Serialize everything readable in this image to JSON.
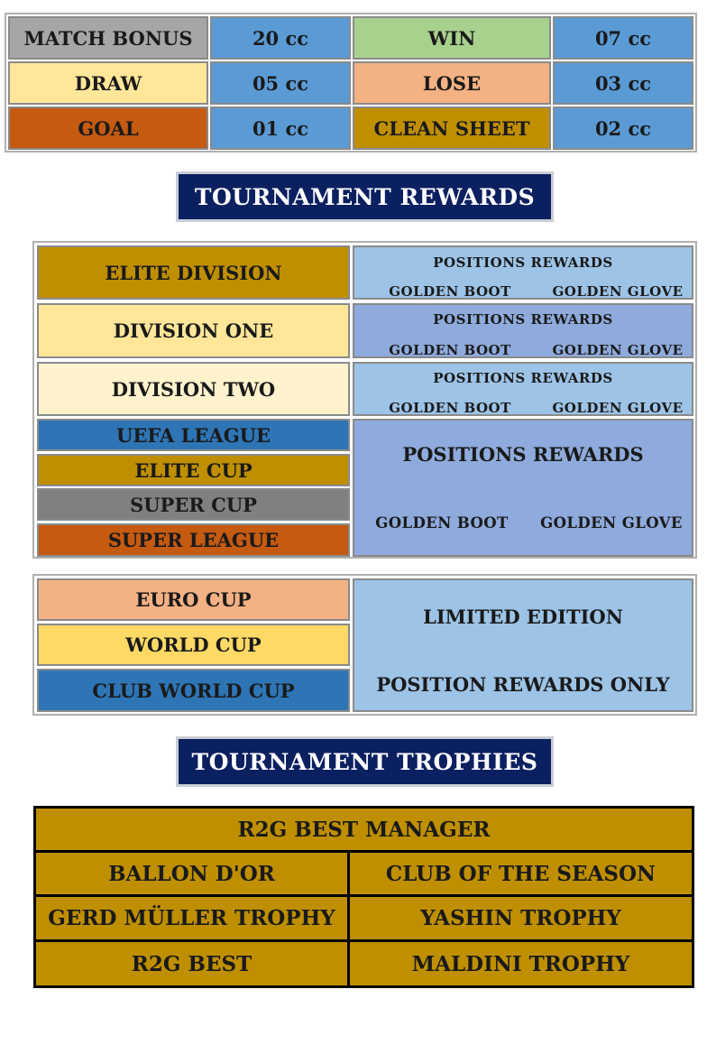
{
  "match_bonus": {
    "rows": [
      [
        {
          "text": "MATCH BONUS",
          "color": "#a6a6a6"
        },
        {
          "text": "20 cc",
          "color": "#5b9bd5"
        },
        {
          "text": "WIN",
          "color": "#a9d18e"
        },
        {
          "text": "07 cc",
          "color": "#5b9bd5"
        }
      ],
      [
        {
          "text": "DRAW",
          "color": "#ffe699"
        },
        {
          "text": "05 cc",
          "color": "#5b9bd5"
        },
        {
          "text": "LOSE",
          "color": "#f4b183"
        },
        {
          "text": "03 cc",
          "color": "#5b9bd5"
        }
      ],
      [
        {
          "text": "GOAL",
          "color": "#c55a11"
        },
        {
          "text": "01 cc",
          "color": "#5b9bd5"
        },
        {
          "text": "CLEAN SHEET",
          "color": "#bf8f00"
        },
        {
          "text": "02 cc",
          "color": "#5b9bd5"
        }
      ]
    ]
  },
  "rewards_banner": "TOURNAMENT REWARDS",
  "divisions": [
    {
      "name": "ELITE DIVISION",
      "color": "#bf8f00",
      "panel_color": "#9dc3e6",
      "positions": "POSITIONS REWARDS",
      "boot": "GOLDEN BOOT",
      "glove": "GOLDEN GLOVE"
    },
    {
      "name": "DIVISION ONE",
      "color": "#ffe699",
      "panel_color": "#8faadc",
      "positions": "POSITIONS REWARDS",
      "boot": "GOLDEN BOOT",
      "glove": "GOLDEN GLOVE"
    },
    {
      "name": "DIVISION TWO",
      "color": "#fff2cc",
      "panel_color": "#9dc3e6",
      "positions": "POSITIONS REWARDS",
      "boot": "GOLDEN BOOT",
      "glove": "GOLDEN GLOVE"
    }
  ],
  "cups": [
    {
      "name": "UEFA LEAGUE",
      "color": "#2e75b6"
    },
    {
      "name": "ELITE CUP",
      "color": "#bf8f00"
    },
    {
      "name": "SUPER CUP",
      "color": "#808080"
    },
    {
      "name": "SUPER LEAGUE",
      "color": "#c55a11"
    }
  ],
  "cups_panel": {
    "positions": "POSITIONS REWARDS",
    "boot": "GOLDEN BOOT",
    "glove": "GOLDEN GLOVE",
    "color": "#8faadc"
  },
  "limited": [
    {
      "name": "EURO CUP",
      "color": "#f4b183"
    },
    {
      "name": "WORLD CUP",
      "color": "#ffd966"
    },
    {
      "name": "CLUB WORLD CUP",
      "color": "#2e75b6"
    }
  ],
  "limited_panel": {
    "title": "LIMITED EDITION",
    "subtitle": "POSITION REWARDS ONLY",
    "color": "#9dc3e6"
  },
  "trophies_banner": "TOURNAMENT TROPHIES",
  "trophies": {
    "top": "R2G BEST MANAGER",
    "rows": [
      [
        "BALLON D'OR",
        "CLUB OF THE SEASON"
      ],
      [
        "GERD MÜLLER TROPHY",
        "YASHIN TROPHY"
      ],
      [
        "R2G BEST",
        "MALDINI TROPHY"
      ]
    ]
  }
}
